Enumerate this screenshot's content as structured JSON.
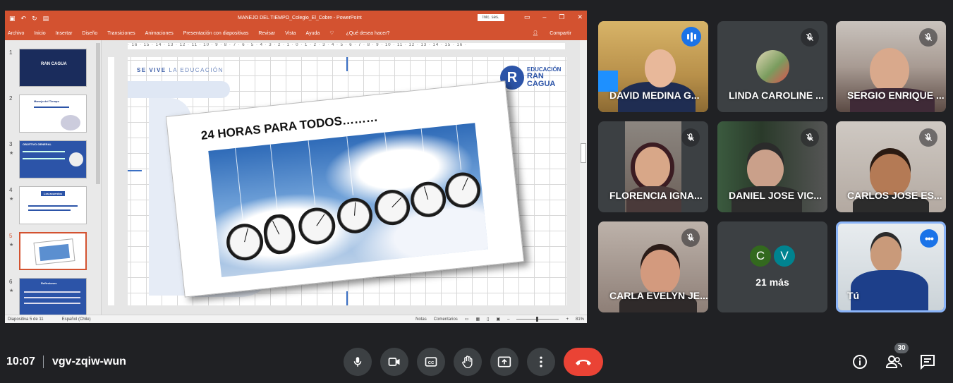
{
  "ppt": {
    "title": "MANEJO DEL TIEMPO_Colegio_El_Cobre  -  PowerPoint",
    "signin": "Inic. ses.",
    "menu": [
      "Archivo",
      "Inicio",
      "Insertar",
      "Diseño",
      "Transiciones",
      "Animaciones",
      "Presentación con diapositivas",
      "Revisar",
      "Vista",
      "Ayuda"
    ],
    "tell_me": "¿Qué desea hacer?",
    "share": "Compartir",
    "thumbnails": [
      {
        "num": "1",
        "title": "RAN CAGUA"
      },
      {
        "num": "2",
        "title": "Manejo del Tiempo"
      },
      {
        "num": "3",
        "title": "OBJETIVO GENERAL"
      },
      {
        "num": "4",
        "title": "Los acuerdos"
      },
      {
        "num": "5",
        "title": ""
      },
      {
        "num": "6",
        "title": "Reflexiones"
      }
    ],
    "ruler": "· 16 · 15 · 14 · 13 · 12 · 11 · 10 · 9 · 8 · 7 · 6 · 5 · 4 · 3 · 2 · 1 · 0 · 1 · 2 · 3 · 4 · 5 · 6 · 7 · 8 · 9 · 10 · 11 · 12 · 13 · 14 · 15 · 16 ·",
    "slide": {
      "tagline_bold": "SE VIVE",
      "tagline_rest": " LA EDUCACIÓN",
      "logo_line1": "EDUCACIÓN",
      "logo_line2": "RAN",
      "logo_line3": "CAGUA",
      "logo_letter": "R",
      "headline": "24 HORAS PARA TODOS………"
    },
    "status": {
      "slide_of": "Diapositiva 5 de 11",
      "language": "Español (Chile)",
      "notes": "Notas",
      "comments": "Comentarios",
      "zoom": "81%"
    }
  },
  "participants": [
    {
      "name": "DAVID MEDINA G...",
      "state": "speaking"
    },
    {
      "name": "LINDA CAROLINE ...",
      "state": "muted"
    },
    {
      "name": "SERGIO ENRIQUE ...",
      "state": "muted"
    },
    {
      "name": "FLORENCIA IGNA...",
      "state": "muted"
    },
    {
      "name": "DANIEL JOSE VIC...",
      "state": "muted"
    },
    {
      "name": "CARLOS JOSE ES...",
      "state": "muted"
    },
    {
      "name": "CARLA EVELYN JE...",
      "state": "muted"
    },
    {
      "name": "Tú",
      "state": "self"
    }
  ],
  "group_tile": {
    "avatars": [
      "C",
      "V"
    ],
    "avatar_colors": [
      "#33691e",
      "#00838f"
    ],
    "more_label": "21 más"
  },
  "meeting": {
    "time": "10:07",
    "code": "vgv-zqiw-wun",
    "participant_count": "30"
  },
  "colors": {
    "accent": "#d35230",
    "end_call": "#ea4335",
    "meet_bg": "#202124",
    "speaking": "#1a73e8"
  }
}
